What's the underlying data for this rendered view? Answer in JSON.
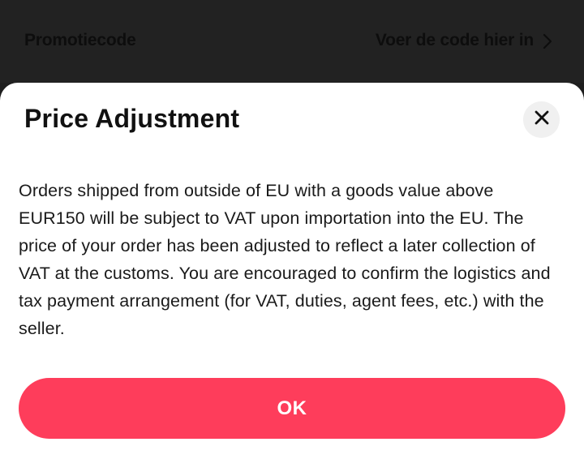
{
  "background_row": {
    "label": "Promotiecode",
    "value": "Voer de code hier in",
    "chevron_icon": "chevron-right-icon"
  },
  "dialog": {
    "title": "Price Adjustment",
    "close_icon": "close-icon",
    "body": "Orders shipped from outside of EU with a goods value above EUR150 will be subject to VAT upon importation into the EU. The price of your order has been adjusted to reflect a later collection of VAT at the customs. You are encouraged to confirm the logistics and tax payment arrangement (for VAT, duties, agent fees, etc.) with the seller.",
    "ok_label": "OK"
  },
  "colors": {
    "accent": "#fe3d5b",
    "backdrop": "#1e1e1e",
    "sheet": "#ffffff",
    "text": "#1a1a1a"
  }
}
